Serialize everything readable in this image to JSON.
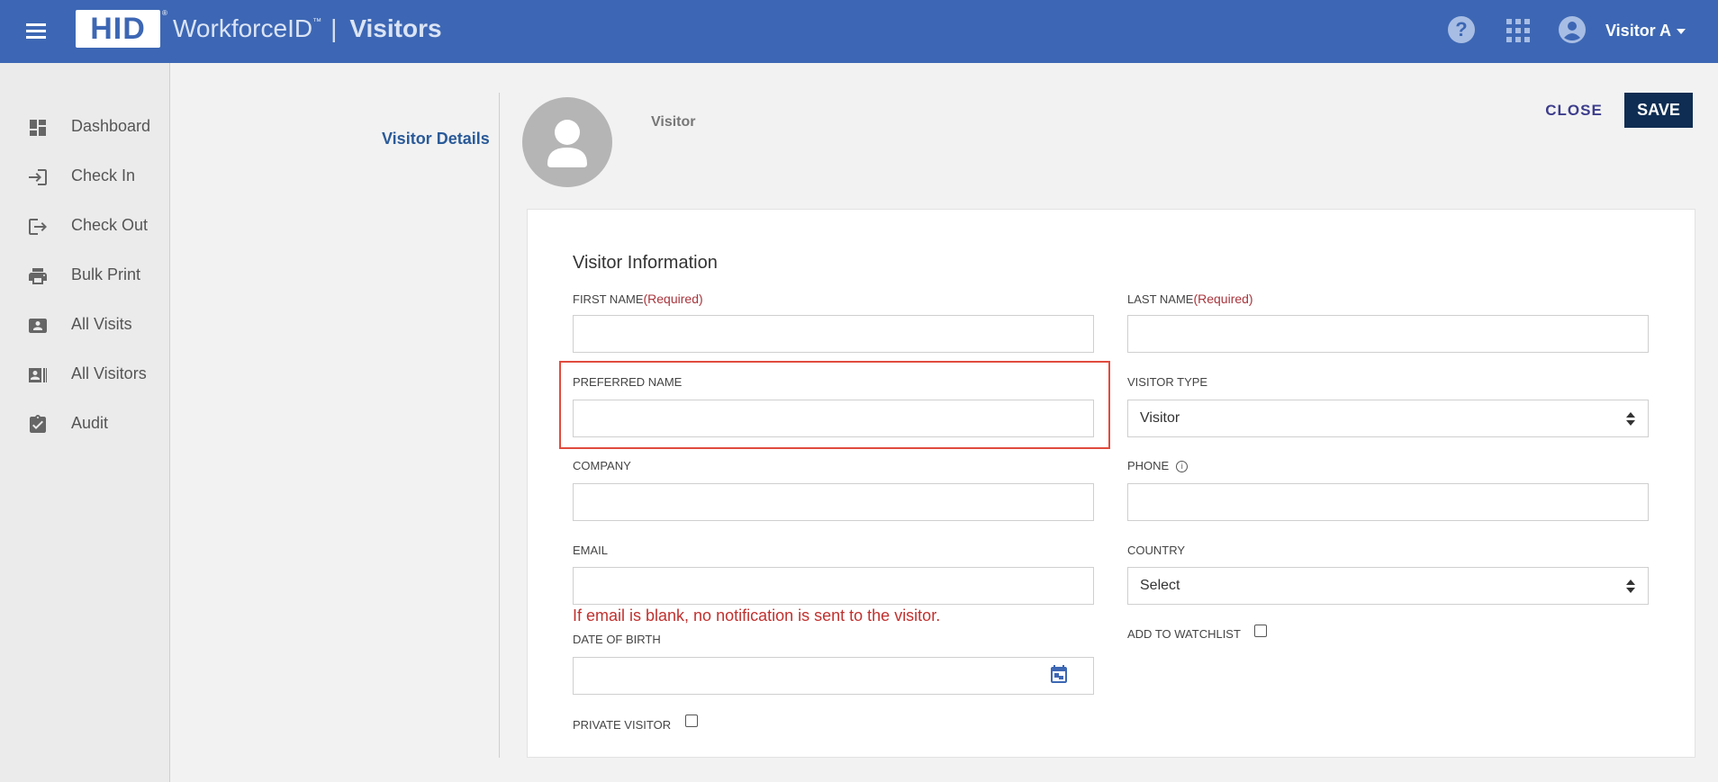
{
  "header": {
    "logo_text": "HID",
    "logo_reg": "®",
    "brand_name": "WorkforceID",
    "brand_tm": "™",
    "separator": "|",
    "app_name": "Visitors",
    "help_glyph": "?",
    "user_name": "Visitor A",
    "icons": [
      "menu-icon",
      "help-icon",
      "apps-grid-icon",
      "account-circle-icon",
      "caret-down-icon"
    ],
    "color": "#3d67b4"
  },
  "sidebar": {
    "items": [
      {
        "label": "Dashboard",
        "icon": "dashboard-icon"
      },
      {
        "label": "Check In",
        "icon": "check-in-icon"
      },
      {
        "label": "Check Out",
        "icon": "check-out-icon"
      },
      {
        "label": "Bulk Print",
        "icon": "printer-icon"
      },
      {
        "label": "All Visits",
        "icon": "visits-card-icon"
      },
      {
        "label": "All Visitors",
        "icon": "visitors-list-icon"
      },
      {
        "label": "Audit",
        "icon": "clipboard-check-icon"
      }
    ]
  },
  "page": {
    "section_title": "Visitor Details",
    "role_label": "Visitor",
    "close_label": "CLOSE",
    "save_label": "SAVE"
  },
  "form": {
    "title": "Visitor Information",
    "required_text": "(Required)",
    "first_name": {
      "label": "FIRST NAME",
      "value": ""
    },
    "last_name": {
      "label": "LAST NAME",
      "value": ""
    },
    "preferred_name": {
      "label": "PREFERRED NAME",
      "value": ""
    },
    "visitor_type": {
      "label": "VISITOR TYPE",
      "value": "Visitor"
    },
    "company": {
      "label": "COMPANY",
      "value": ""
    },
    "phone": {
      "label": "PHONE",
      "info_glyph": "i",
      "value": ""
    },
    "email": {
      "label": "EMAIL",
      "value": "",
      "hint": "If email is blank, no notification is sent to the visitor."
    },
    "country": {
      "label": "COUNTRY",
      "value": "Select"
    },
    "date_of_birth": {
      "label": "DATE OF BIRTH",
      "value": ""
    },
    "add_to_watchlist": {
      "label": "ADD TO WATCHLIST",
      "checked": false
    },
    "private_visitor": {
      "label": "PRIVATE VISITOR",
      "checked": false
    }
  },
  "colors": {
    "header_bg": "#3d67b4",
    "save_bg": "#0f2d52",
    "required": "#a9343b",
    "error": "#c0312f",
    "highlight": "#e04b3e"
  }
}
